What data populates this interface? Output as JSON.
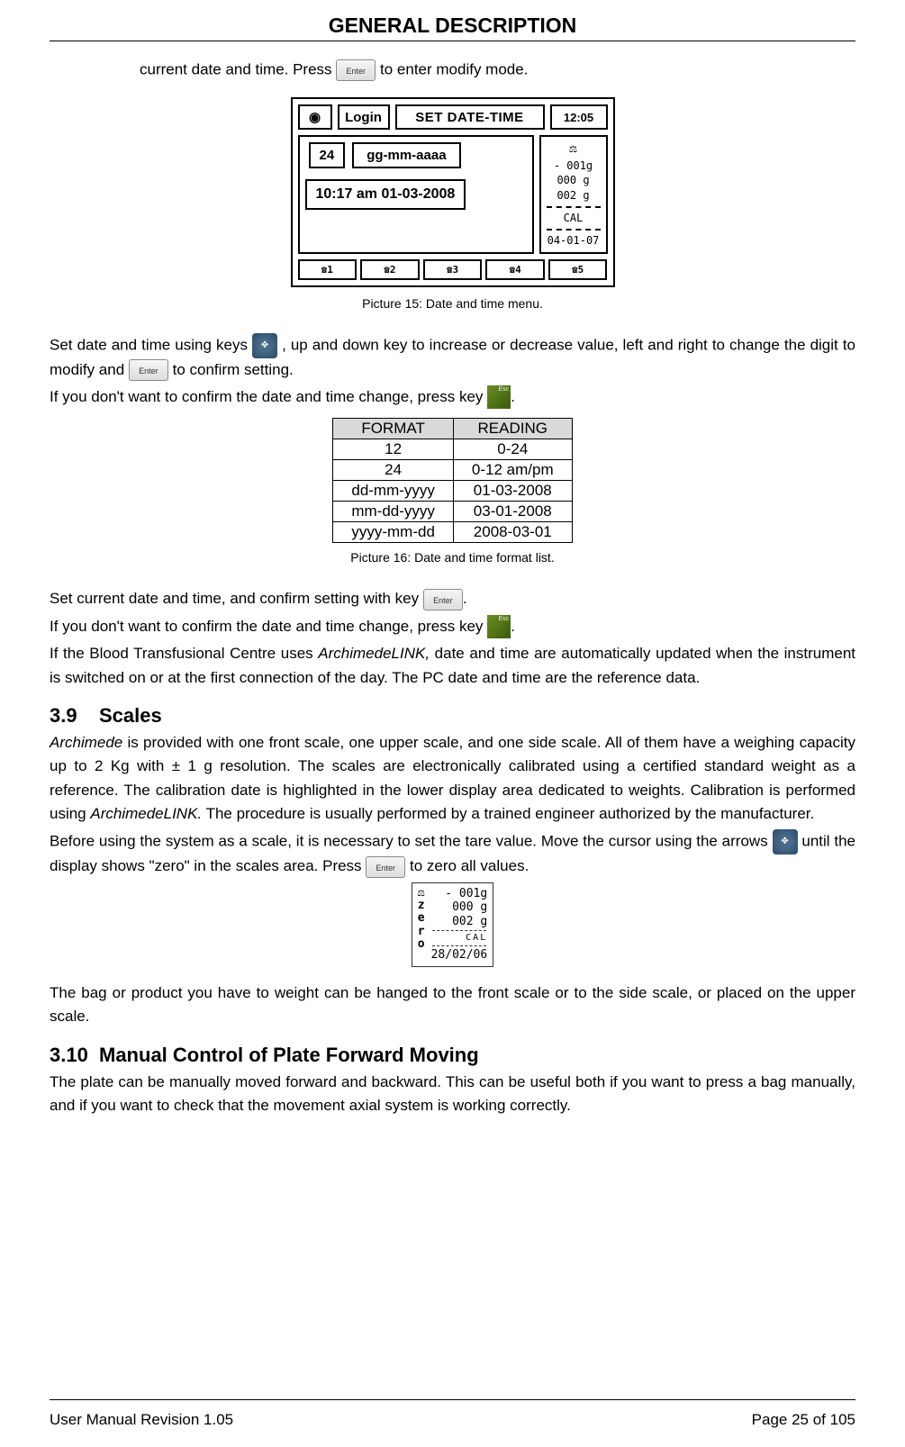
{
  "header": {
    "title": "GENERAL DESCRIPTION"
  },
  "intro": {
    "text_before": "current date and time. Press ",
    "text_after": " to enter modify mode.",
    "key": "Enter"
  },
  "figure15": {
    "login": "Login",
    "title": "SET DATE-TIME",
    "time_top": "12:05",
    "value24": "24",
    "format": "gg-mm-aaaa",
    "datetime": "10:17 am 01-03-2008",
    "side_line1": "- 001g",
    "side_line2": "000 g",
    "side_line3": "002 g",
    "side_cal": "CAL",
    "side_caldate": "04-01-07",
    "fn1": "☎1",
    "fn2": "☎2",
    "fn3": "☎3",
    "fn4": "☎4",
    "fn5": "☎5",
    "caption": "Picture 15: Date and time menu."
  },
  "para1": {
    "p1a": "Set date and time using keys ",
    "p1b": " , up and down key to increase or decrease value, left and right to change the digit to modify and ",
    "p1c": " to confirm setting.",
    "p2a": "If you don't want to confirm the date and time change, press key",
    "p2b": ".",
    "key_enter": "Enter",
    "key_esc": "Esc"
  },
  "format_table": {
    "headers": [
      "FORMAT",
      "READING"
    ],
    "rows": [
      [
        "12",
        "0-24"
      ],
      [
        "24",
        "0-12 am/pm"
      ],
      [
        "dd-mm-yyyy",
        "01-03-2008"
      ],
      [
        "mm-dd-yyyy",
        "03-01-2008"
      ],
      [
        "yyyy-mm-dd",
        "2008-03-01"
      ]
    ],
    "caption": "Picture 16: Date and time format list."
  },
  "para2": {
    "p1a": "Set current date and time, and confirm setting with key ",
    "p1b": ".",
    "p2a": "If you don't want to confirm the date and time change, press key",
    "p2b": ".",
    "p3a": "If the Blood Transfusional Centre uses ",
    "p3_italic": "ArchimedeLINK,",
    "p3b": " date and time are automatically updated when the instrument is switched on or at the first connection of the day. The PC date and time are the reference data.",
    "key_enter": "Enter",
    "key_esc": "Esc"
  },
  "section39": {
    "num": "3.9",
    "title": "Scales",
    "p1a_italic": "Archimede",
    "p1a": " is provided with one front scale, one upper scale, and one side scale. All of them have a weighing capacity up to 2 Kg with ± 1 g resolution. The scales are electronically calibrated using a certified standard weight as a reference. The calibration date is highlighted in the lower display area dedicated to weights. Calibration is performed using  ",
    "p1b_italic": "ArchimedeLINK.",
    "p1c": " The procedure is usually performed by a trained engineer authorized by the manufacturer.",
    "p2a": "Before using the system as a scale, it is necessary to set the tare value. Move the cursor using the arrows ",
    "p2b": "  until the display shows \"zero\" in the scales area. Press ",
    "p2c": " to zero all values.",
    "key_enter": "Enter"
  },
  "scale_figure": {
    "zero_label": "zero",
    "line1": "- 001g",
    "line2": "000 g",
    "line3": "002 g",
    "cal": "CAL",
    "caldate": "28/02/06"
  },
  "para3": {
    "text": "The bag or product you have to weight can be hanged to the front scale or to the side scale, or placed on the upper scale."
  },
  "section310": {
    "num": "3.10",
    "title": "Manual Control of Plate Forward Moving",
    "text": "The plate can be manually moved forward and backward. This can be useful both if you want to press a bag manually, and if you want to check that the movement axial system is working correctly."
  },
  "footer": {
    "left": "User Manual Revision 1.05",
    "right": "Page 25 of 105"
  }
}
